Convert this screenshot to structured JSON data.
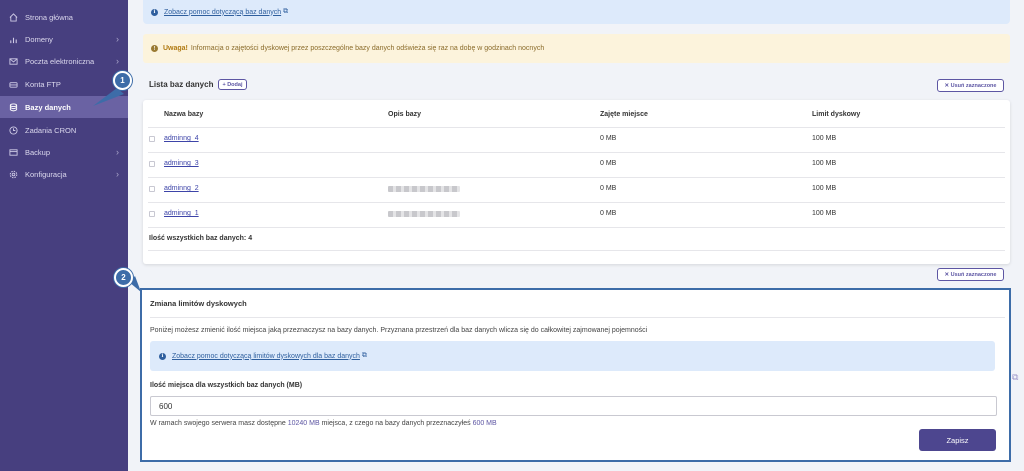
{
  "sidebar": {
    "items": [
      {
        "label": "Strona główna",
        "icon": "home-icon",
        "chevron": false,
        "active": false
      },
      {
        "label": "Domeny",
        "icon": "bar-chart-icon",
        "chevron": true,
        "active": false
      },
      {
        "label": "Poczta elektroniczna",
        "icon": "mail-icon",
        "chevron": true,
        "active": false
      },
      {
        "label": "Konta FTP",
        "icon": "drive-icon",
        "chevron": false,
        "active": false
      },
      {
        "label": "Bazy danych",
        "icon": "database-icon",
        "chevron": false,
        "active": true
      },
      {
        "label": "Zadania CRON",
        "icon": "clock-icon",
        "chevron": false,
        "active": false
      },
      {
        "label": "Backup",
        "icon": "archive-icon",
        "chevron": true,
        "active": false
      },
      {
        "label": "Konfiguracja",
        "icon": "gear-icon",
        "chevron": true,
        "active": false
      }
    ]
  },
  "markers": {
    "one": "1",
    "two": "2"
  },
  "top_info": {
    "link": "Zobacz pomoc dotyczącą baz danych"
  },
  "warning": {
    "bold": "Uwaga!",
    "text": "Informacja o zajętości dyskowej przez poszczególne bazy danych odświeża się raz na dobę w godzinach nocnych"
  },
  "list": {
    "title": "Lista baz danych",
    "add_label": "+ Dodaj",
    "remove_label": "✕ Usuń zaznaczone",
    "headers": {
      "name": "Nazwa bazy",
      "desc": "Opis bazy",
      "used": "Zajęte miejsce",
      "limit": "Limit dyskowy"
    },
    "rows": [
      {
        "name": "adminng_4",
        "has_desc": false,
        "used": "0 MB",
        "limit": "100 MB"
      },
      {
        "name": "adminng_3",
        "has_desc": false,
        "used": "0 MB",
        "limit": "100 MB"
      },
      {
        "name": "adminng_2",
        "has_desc": true,
        "used": "0 MB",
        "limit": "100 MB"
      },
      {
        "name": "adminng_1",
        "has_desc": true,
        "used": "0 MB",
        "limit": "100 MB"
      }
    ],
    "total": "Ilość wszystkich baz danych: 4"
  },
  "limits": {
    "title": "Zmiana limitów dyskowych",
    "description": "Poniżej możesz zmienić ilość miejsca jaką przeznaczysz na bazy danych. Przyznana przestrzeń dla baz danych wlicza się do całkowitej zajmowanej pojemności",
    "help_link": "Zobacz pomoc dotyczącą limitów dyskowych dla baz danych",
    "field_label": "Ilość miejsca dla wszystkich baz danych (MB)",
    "field_value": "600",
    "hint_pre": "W ramach swojego serwera masz dostępne ",
    "hint_available": "10240 MB",
    "hint_mid": " miejsca, z czego na bazy danych przeznaczyłeś ",
    "hint_assigned": "600 MB",
    "save_label": "Zapisz"
  },
  "colors": {
    "sidebar": "#473f7f",
    "sidebar_active": "#6a62a3",
    "accent": "#4d468f",
    "marker": "#3d6ca8"
  }
}
